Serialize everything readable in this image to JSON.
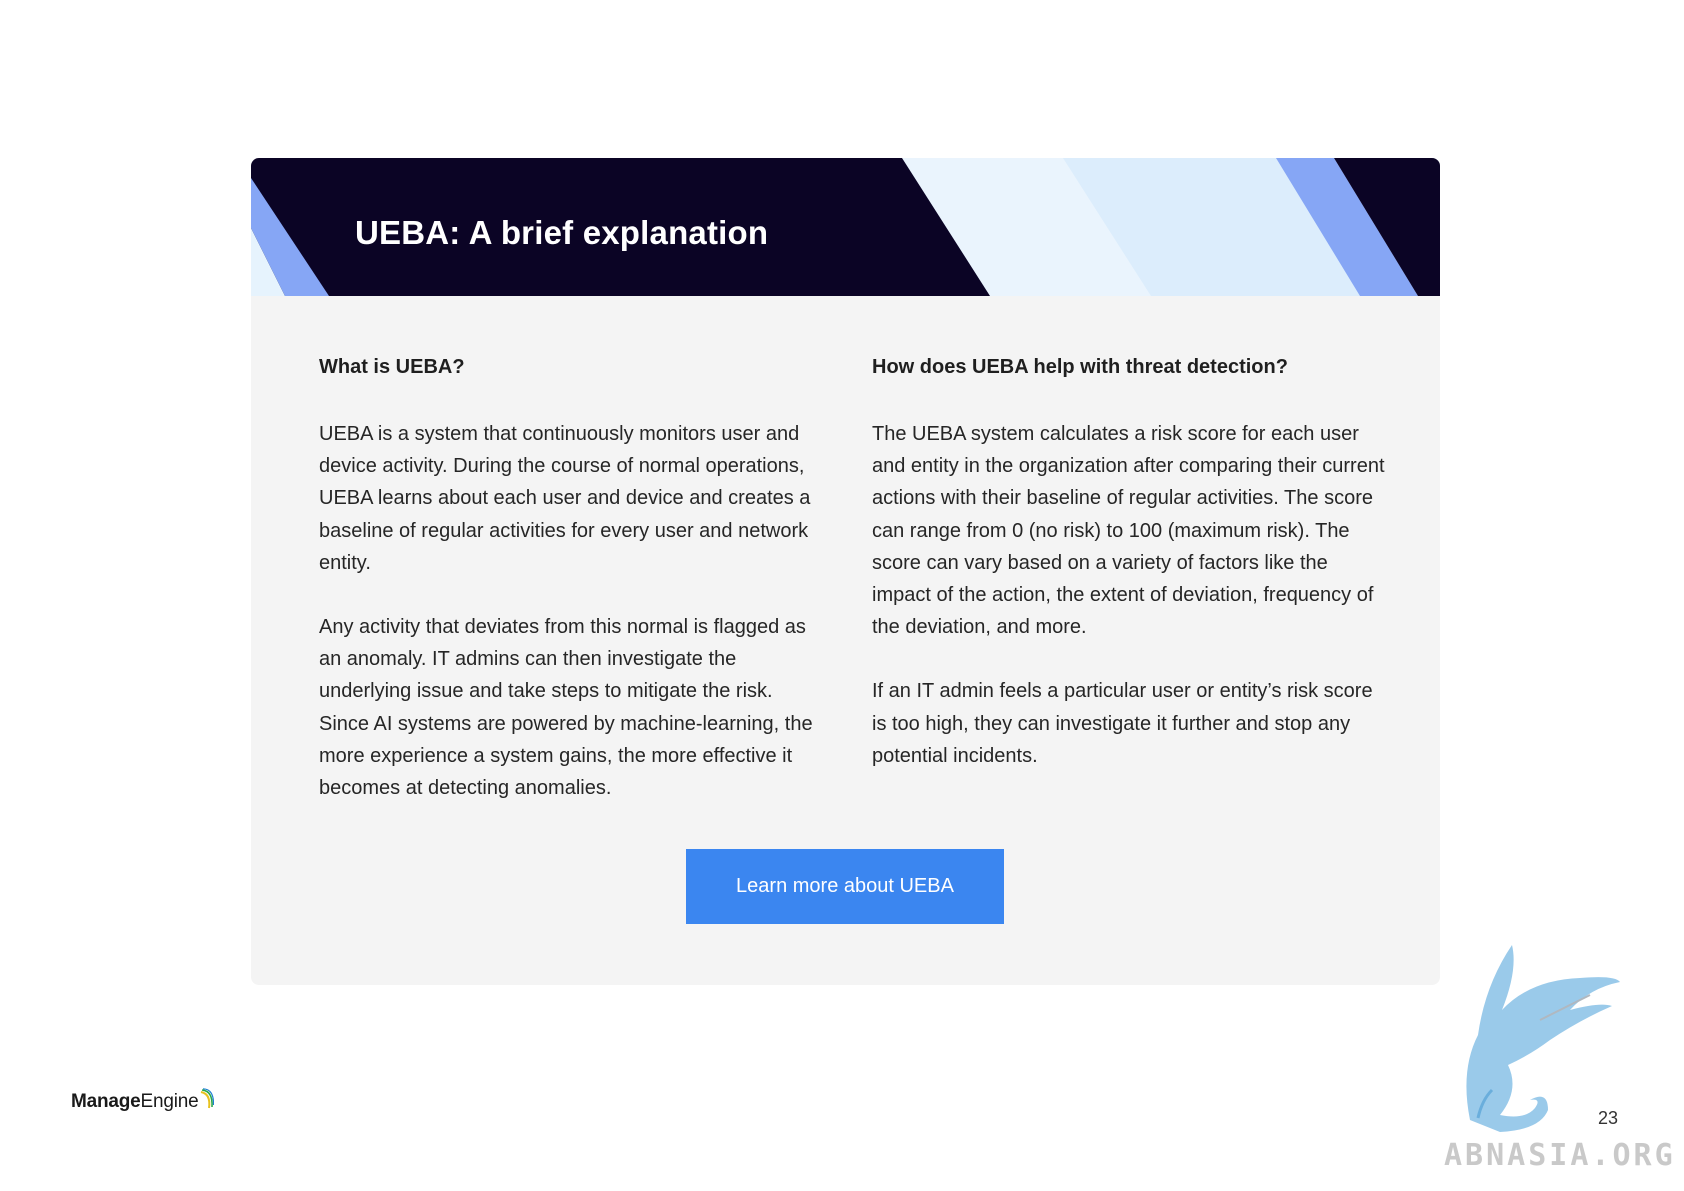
{
  "banner": {
    "title": "UEBA: A brief explanation"
  },
  "left_column": {
    "heading": "What is UEBA?",
    "paragraphs": [
      "UEBA is a system that continuously monitors user and device activity. During the course of normal operations, UEBA learns about each user and device and creates a baseline of regular activities for every user and network entity.",
      "Any activity that deviates from this normal is flagged as an anomaly. IT admins can then investigate the underlying issue and take steps to mitigate the risk. Since AI systems are powered by machine-learning, the more experience a system gains, the more effective it becomes at detecting anomalies."
    ]
  },
  "right_column": {
    "heading": "How does UEBA help with threat detection?",
    "paragraphs": [
      "The UEBA system calculates a risk score for each user and entity in the organization after comparing their current actions with their baseline of regular activities. The score can range from 0 (no risk) to 100 (maximum risk). The score can vary based on a variety of factors like the impact of the action, the extent of deviation, frequency of the deviation, and more.",
      "If an IT admin feels a particular user or entity’s risk score is too high, they can investigate it further and stop any potential incidents."
    ]
  },
  "cta": {
    "label": "Learn more about UEBA"
  },
  "footer": {
    "logo_bold": "Manage",
    "logo_regular": "Engine",
    "page_number": "23",
    "watermark_text": "ABNASIA.ORG"
  },
  "colors": {
    "banner_bg": "#0b0425",
    "card_bg": "#f4f4f4",
    "cta_bg": "#3b86f0",
    "stripe_blue": "#86a6f5",
    "stripe_light": "#e3f1fc"
  }
}
